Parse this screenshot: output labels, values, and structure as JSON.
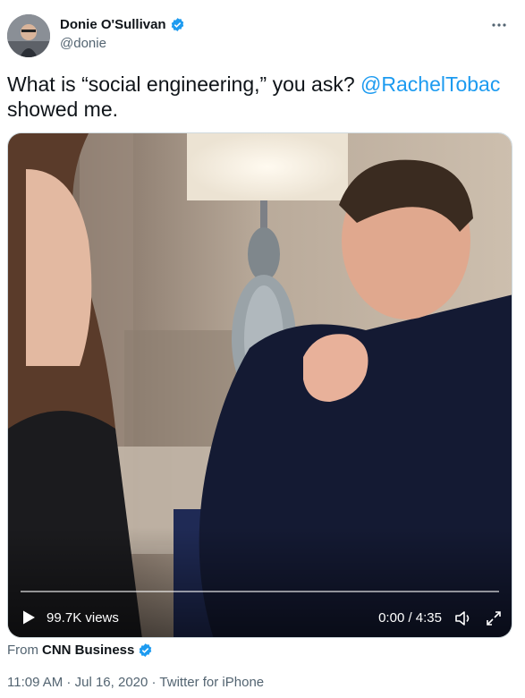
{
  "author": {
    "display_name": "Donie O'Sullivan",
    "handle": "@donie",
    "verified": true
  },
  "tweet": {
    "text_before": "What is “social engineering,” you ask? ",
    "mention": "@RachelTobac",
    "text_after": "showed me."
  },
  "video": {
    "views": "99.7K views",
    "time": "0:00 / 4:35",
    "progress_fraction": 0
  },
  "source": {
    "prefix": "From",
    "name": "CNN Business",
    "verified": true
  },
  "meta": {
    "time": "11:09 AM",
    "separator": " · ",
    "date": "Jul 16, 2020",
    "client": "Twitter for iPhone"
  },
  "colors": {
    "accent": "#1d9bf0",
    "text": "#0f1419",
    "secondary": "#536471"
  },
  "icons": [
    "verified-icon",
    "more-icon",
    "play-icon",
    "volume-icon",
    "expand-icon"
  ]
}
